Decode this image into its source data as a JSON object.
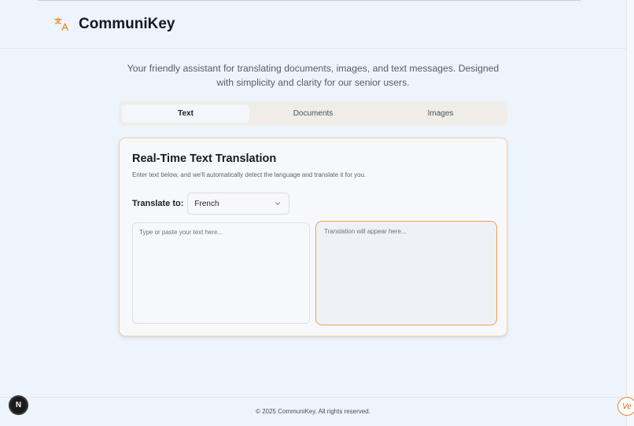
{
  "header": {
    "brand": "CommuniKey",
    "logo_icon": "translate-icon",
    "accent": "#e8963f"
  },
  "tagline": "Your friendly assistant for translating documents, images, and text messages. Designed with simplicity and clarity for our senior users.",
  "tabs": [
    {
      "label": "Text",
      "active": true
    },
    {
      "label": "Documents",
      "active": false
    },
    {
      "label": "Images",
      "active": false
    }
  ],
  "card": {
    "title": "Real-Time Text Translation",
    "description": "Enter text below, and we'll automatically detect the language and translate it for you.",
    "translate_to_label": "Translate to:",
    "selected_language": "French",
    "source_placeholder": "Type or paste your text here...",
    "output_placeholder": "Translation will appear here..."
  },
  "footer": {
    "copyright": "© 2025 CommuniKey. All rights reserved."
  },
  "overlays": {
    "dev_badge": "N",
    "corner_badge": "Ve"
  }
}
